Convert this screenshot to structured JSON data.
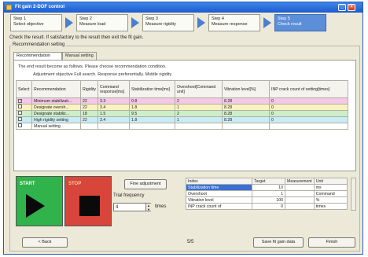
{
  "window": {
    "title": "Fit gain 2-DOF control"
  },
  "steps": [
    {
      "label": "Step 1",
      "sub": "Select objective"
    },
    {
      "label": "Step 2",
      "sub": "Measure load"
    },
    {
      "label": "Step 3",
      "sub": "Measure rigidity"
    },
    {
      "label": "Step 4",
      "sub": "Measure response"
    },
    {
      "label": "Step 5",
      "sub": "Check result"
    }
  ],
  "instruction": "Check the result. If satisfactory to the result then exit the fit gain.",
  "group_label": "Recommendation setting",
  "tabs": [
    "Recommendation setting",
    "Manual setting"
  ],
  "panel": {
    "line1": "The end result become as follows. Please choose recommendation condition.",
    "line2": "Adjustment objective Full search. Response preferentially. Middle rigidity"
  },
  "rec_table": {
    "headers": [
      "Select",
      "Recommendation",
      "Rigidity",
      "Command response[ms]",
      "Stabilization time[ms]",
      "Overshoot[Command unit]",
      "Vibration level[%]",
      "INP crack count of setting[times]"
    ],
    "rows": [
      {
        "checked": "✓",
        "name": "Minimum stabilizati...",
        "rigidity": "22",
        "cmd": "3.3",
        "stab": "0.8",
        "over": "2",
        "vib": "8.28",
        "inp": "0",
        "color": "#f3c9e6"
      },
      {
        "checked": "",
        "name": "Designate oversh...",
        "rigidity": "22",
        "cmd": "3.4",
        "stab": "1.8",
        "over": "1",
        "vib": "8.28",
        "inp": "0",
        "color": "#fbf3bf"
      },
      {
        "checked": "",
        "name": "Designate stabiliz...",
        "rigidity": "18",
        "cmd": "1.5",
        "stab": "9.5",
        "over": "2",
        "vib": "8.28",
        "inp": "0",
        "color": "#cdeec9"
      },
      {
        "checked": "",
        "name": "High rigidity setting",
        "rigidity": "22",
        "cmd": "3.4",
        "stab": "1.8",
        "over": "1",
        "vib": "8.28",
        "inp": "0",
        "color": "#c8ecf3"
      },
      {
        "checked": "",
        "name": "Manual setting",
        "rigidity": "",
        "cmd": "",
        "stab": "",
        "over": "",
        "vib": "",
        "inp": "",
        "color": "#ffffff"
      }
    ]
  },
  "start_label": "START",
  "stop_label": "STOP",
  "fine_adjust_label": "Fine adjustment",
  "trial_label": "Trial frequency",
  "trial_value": "4",
  "times_label": "times",
  "index_table": {
    "headers": [
      "Index",
      "Target",
      "Measurement",
      "Unit"
    ],
    "rows": [
      {
        "index": "Stabilization time",
        "target": "10",
        "meas": "",
        "unit": "ms",
        "hl": true
      },
      {
        "index": "Overshoot",
        "target": "1",
        "meas": "",
        "unit": "Command",
        "hl": false
      },
      {
        "index": "Vibration level",
        "target": "100",
        "meas": "",
        "unit": "%",
        "hl": false
      },
      {
        "index": "INP crack count of",
        "target": "0",
        "meas": "",
        "unit": "times",
        "hl": false
      }
    ]
  },
  "back_label": "< Back",
  "page_indicator": "5/5",
  "save_label": "Save fit gain data",
  "finish_label": "Finish"
}
